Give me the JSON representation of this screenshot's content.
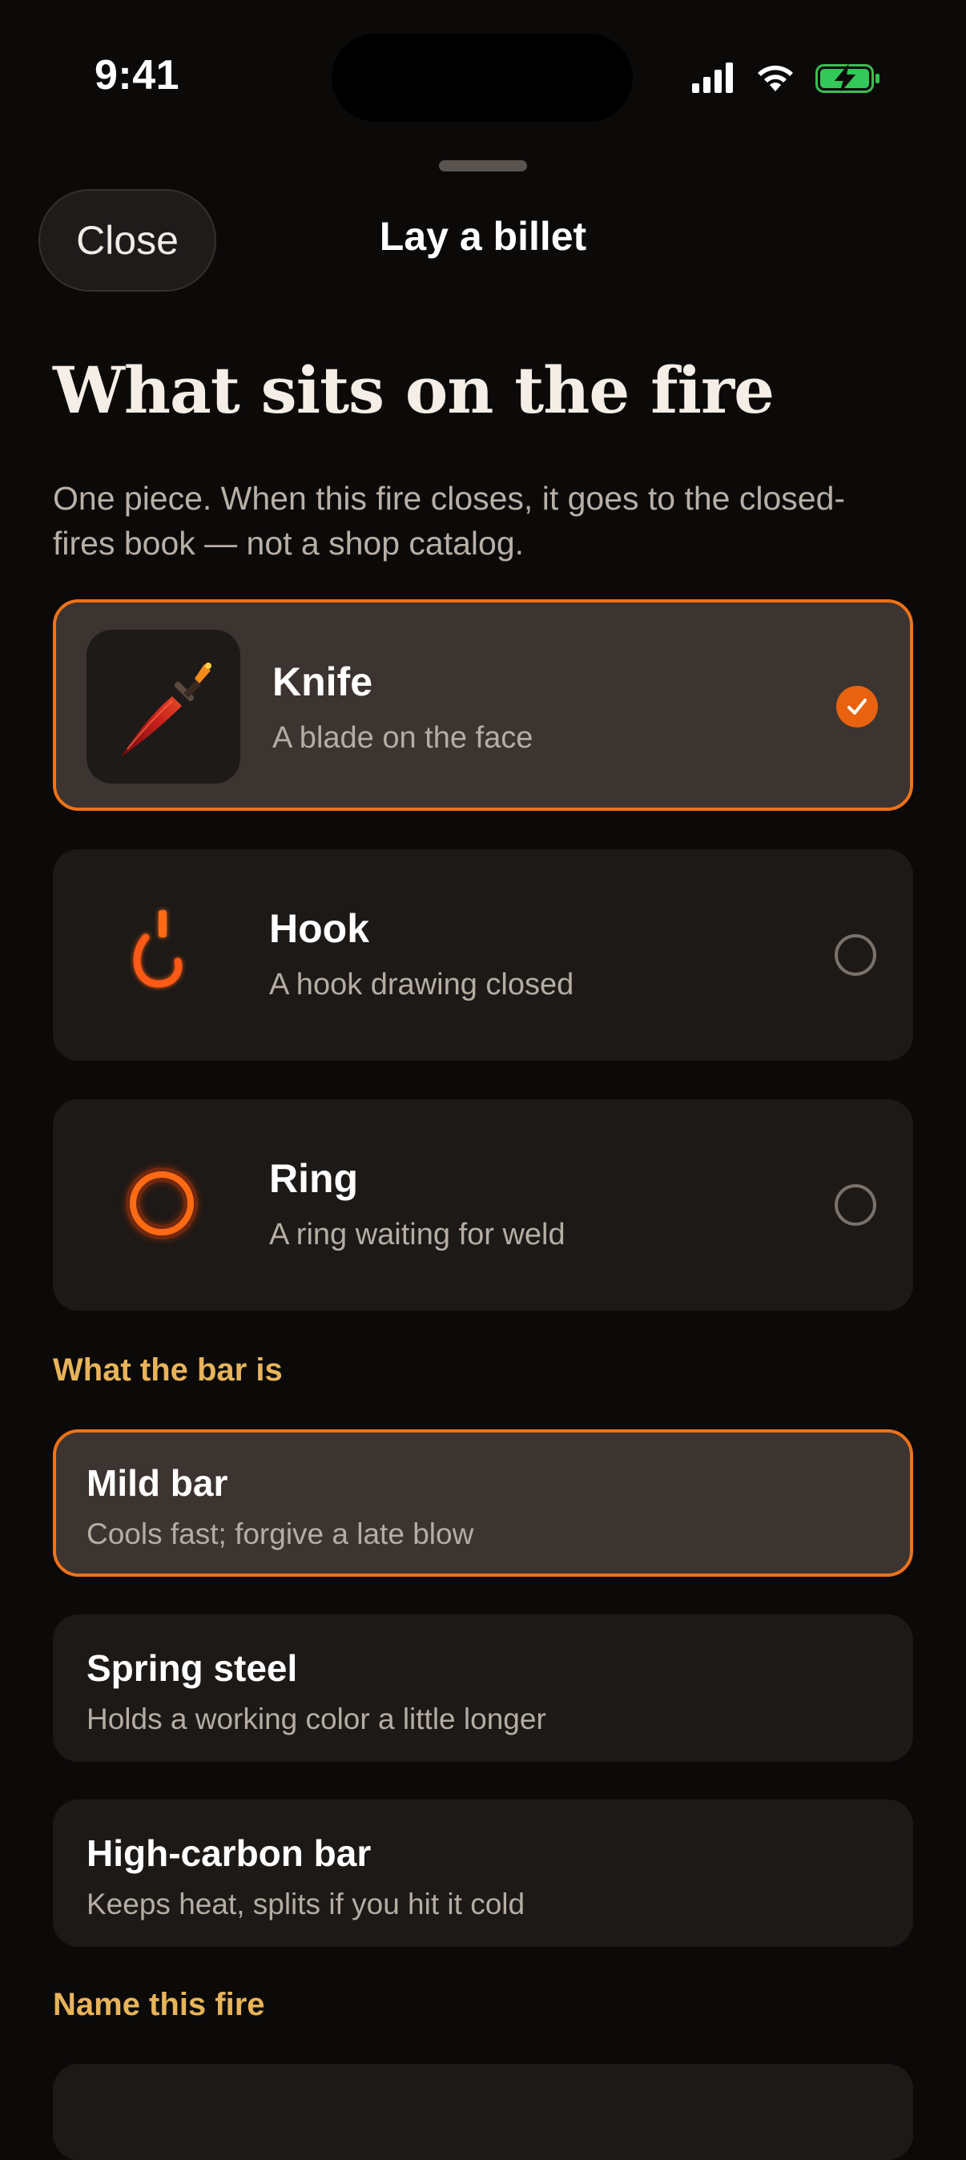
{
  "status_bar": {
    "time": "9:41"
  },
  "header": {
    "close_label": "Close",
    "title": "Lay a billet"
  },
  "intro": {
    "title": "What sits on the fire",
    "subtitle": "One piece. When this fire closes, it goes to the closed-fires book — not a shop catalog."
  },
  "pieces": [
    {
      "name": "Knife",
      "desc": "A blade on the face",
      "icon": "knife-icon",
      "selected": true
    },
    {
      "name": "Hook",
      "desc": "A hook drawing closed",
      "icon": "hook-icon",
      "selected": false
    },
    {
      "name": "Ring",
      "desc": "A ring waiting for weld",
      "icon": "ring-icon",
      "selected": false
    }
  ],
  "bar_section": {
    "label": "What the bar is",
    "options": [
      {
        "name": "Mild bar",
        "desc": "Cools fast; forgive a late blow",
        "selected": true
      },
      {
        "name": "Spring steel",
        "desc": "Holds a working color a little longer",
        "selected": false
      },
      {
        "name": "High-carbon bar",
        "desc": "Keeps heat, splits if you hit it cold",
        "selected": false
      }
    ]
  },
  "name_section": {
    "label": "Name this fire",
    "value": ""
  },
  "colors": {
    "accent": "#f07218",
    "section_label": "#e8b45a",
    "selected_card": "#3c3430",
    "card": "#1c1917",
    "background": "#0c0a09"
  }
}
